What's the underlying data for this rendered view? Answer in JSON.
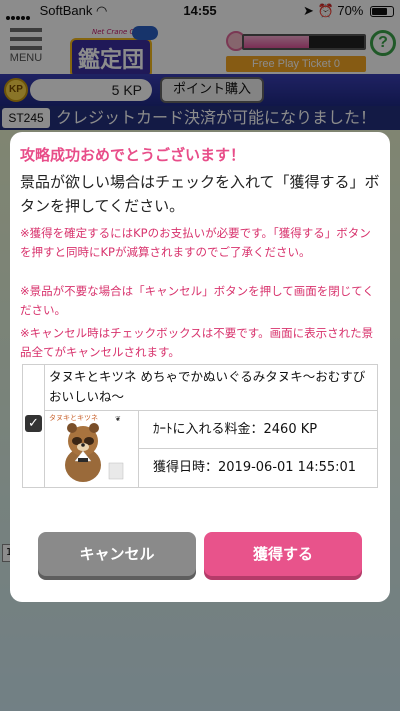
{
  "status_bar": {
    "carrier": "SoftBank",
    "time": "14:55",
    "battery": "70%"
  },
  "header": {
    "menu_label": "MENU",
    "logo_text": "鑑定団",
    "logo_sub": "Net Crane Game",
    "power_percent": "54%",
    "power_level": 0.54,
    "help_label": "?",
    "ticket_text": "Free Play Ticket 0"
  },
  "kp_bar": {
    "icon_label": "KP",
    "value": "5 KP",
    "buy_label": "ポイント購入"
  },
  "ticker": {
    "tag": "ST245",
    "text": "クレジットカード決済が可能になりました！"
  },
  "background": {
    "row_number": "1"
  },
  "modal": {
    "title": "攻略成功おめでとうございます！",
    "instruction": "景品が欲しい場合はチェックを入れて「獲得する」ボタンを押してください。",
    "note1": "※獲得を確定するにはKPのお支払いが必要です。「獲得する」ボタンを押すと同時にKPが減算されますのでご了承ください。",
    "note2": "※景品が不要な場合は「キャンセル」ボタンを押して画面を閉じてください。",
    "note3": "※キャンセル時はチェックボックスは不要です。画面に表示された景品全てがキャンセルされます。",
    "prize": {
      "checked": true,
      "check_mark": "✓",
      "name": "タヌキとキツネ めちゃでかぬいぐるみタヌキ～おむすびおいしいね～",
      "image_label": "タヌキとキツネ",
      "price": "ｶｰﾄに入れる料金：2460 KP",
      "acquired": "獲得日時：2019-06-01 14:55:01"
    },
    "cancel_label": "キャンセル",
    "acquire_label": "獲得する"
  },
  "colors": {
    "accent_pink": "#e8538b",
    "note_red": "#d8336d",
    "kp_blue": "#2a3290",
    "cancel_gray": "#8a8a8a"
  }
}
